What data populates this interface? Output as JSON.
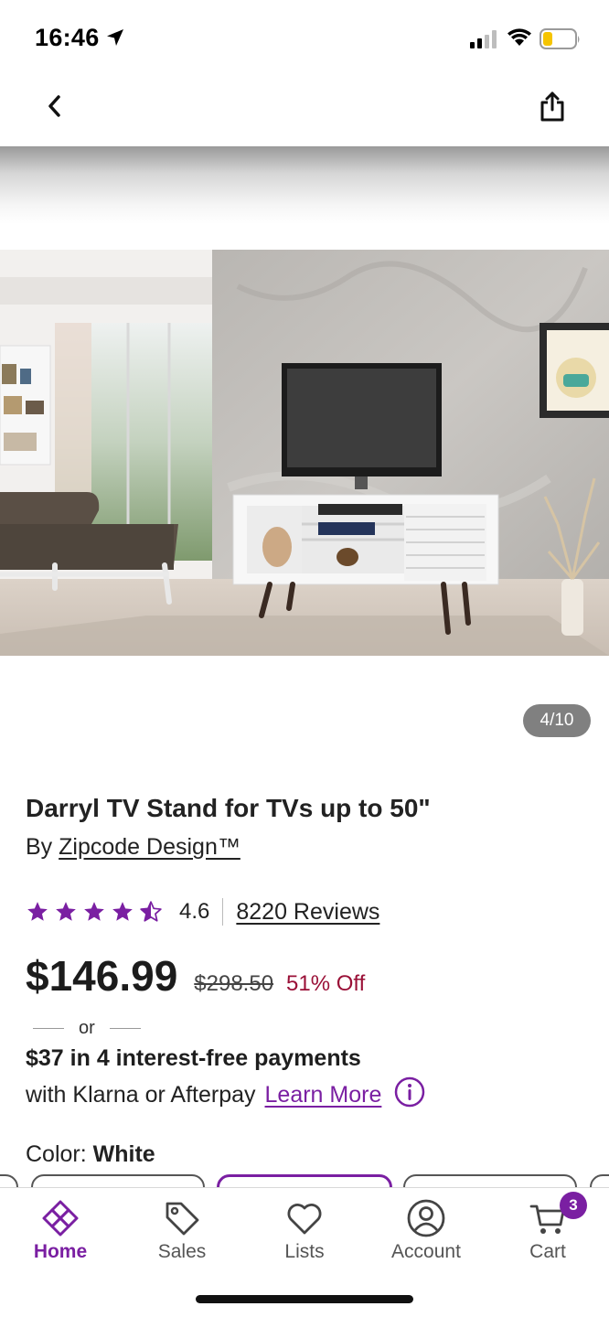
{
  "status_bar": {
    "time": "16:46",
    "icons": [
      "location-arrow-icon",
      "cellular-signal-icon",
      "wifi-icon",
      "battery-low-icon"
    ],
    "battery_color": "#f5c400"
  },
  "nav": {
    "icons": [
      "back-chevron-icon",
      "share-icon"
    ]
  },
  "gallery": {
    "counter": "4/10",
    "current_index": 4,
    "total": 10
  },
  "product": {
    "title": "Darryl TV Stand for TVs up to 50\"",
    "brand_prefix": "By",
    "brand": "Zipcode Design™",
    "rating": 4.6,
    "rating_text": "4.6",
    "rating_max": 5,
    "reviews": "8220 Reviews",
    "price": "$146.99",
    "original_price": "$298.50",
    "discount": "51% Off",
    "or_text": "or",
    "installments": "$37 in 4 interest-free payments",
    "installments_provider": "with Klarna or Afterpay",
    "learn_more": "Learn More",
    "color_label": "Color:",
    "color_value": "White"
  },
  "colors": {
    "accent": "#7a1fa2",
    "star": "#7a1fa2",
    "discount": "#9a1037",
    "counter_bg": "#808080"
  },
  "tabs": [
    {
      "label": "Home",
      "icon": "home-icon",
      "active": true
    },
    {
      "label": "Sales",
      "icon": "tag-icon",
      "active": false
    },
    {
      "label": "Lists",
      "icon": "heart-icon",
      "active": false
    },
    {
      "label": "Account",
      "icon": "account-icon",
      "active": false
    },
    {
      "label": "Cart",
      "icon": "cart-icon",
      "active": false,
      "badge": "3"
    }
  ]
}
